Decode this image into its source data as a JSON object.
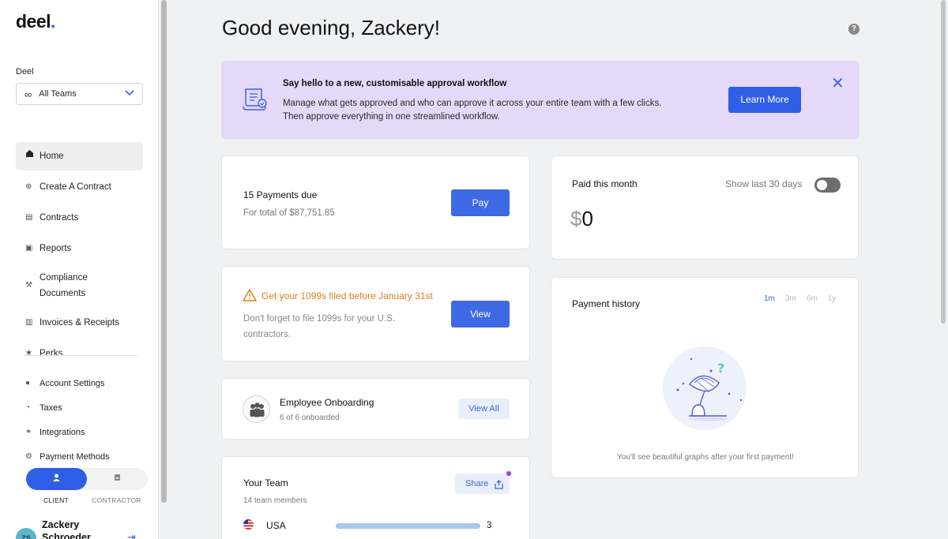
{
  "brand": {
    "name": "deel",
    "dot": "."
  },
  "sidebar": {
    "org_label": "Deel",
    "team_select": {
      "value": "All Teams"
    },
    "nav": [
      {
        "label": "Home",
        "icon": "home-icon",
        "active": true
      },
      {
        "label": "Create A Contract",
        "icon": "plus-circle-icon"
      },
      {
        "label": "Contracts",
        "icon": "document-icon"
      },
      {
        "label": "Reports",
        "icon": "reports-icon"
      },
      {
        "label": "Compliance Documents",
        "icon": "wrench-icon"
      },
      {
        "label": "Invoices & Receipts",
        "icon": "invoice-icon"
      },
      {
        "label": "Perks",
        "icon": "star-icon"
      }
    ],
    "nav_secondary": [
      {
        "label": "Account Settings",
        "icon": "user-icon"
      },
      {
        "label": "Taxes",
        "icon": "pie-icon"
      },
      {
        "label": "Integrations",
        "icon": "link-icon"
      },
      {
        "label": "Payment Methods",
        "icon": "gear-icon"
      }
    ],
    "role_toggle": {
      "client_label": "CLIENT",
      "contractor_label": "CONTRACTOR",
      "selected": "CLIENT"
    },
    "user": {
      "initials": "ZS",
      "name": "Zackery Schroeder"
    }
  },
  "main": {
    "greeting": "Good evening, Zackery!",
    "help_icon": "?",
    "banner": {
      "title": "Say hello to a new, customisable approval workflow",
      "text": "Manage what gets approved and who can approve it across your entire team with a few clicks. Then approve everything in one streamlined workflow.",
      "button": "Learn More",
      "close": "✕",
      "bg_color": "#e5d8f8"
    },
    "payments": {
      "title": "15 Payments due",
      "subtitle": "For total of $87,751.85",
      "button": "Pay"
    },
    "tax_1099": {
      "title": "Get your 1099s filed before January 31st",
      "subtitle": "Don't forget to file 1099s for your U.S. contractors.",
      "button": "View"
    },
    "onboarding": {
      "title": "Employee Onboarding",
      "subtitle": "6 of 6 onboarded",
      "button": "View All"
    },
    "team": {
      "title": "Your Team",
      "subtitle": "14 team members",
      "share_button": "Share",
      "countries": [
        {
          "name": "USA",
          "count": "3"
        }
      ]
    },
    "paid": {
      "title": "Paid this month",
      "toggle_label": "Show last 30 days",
      "toggle_on": false,
      "currency": "$",
      "amount": "0"
    },
    "history": {
      "title": "Payment history",
      "ranges": [
        "1m",
        "3m",
        "6m",
        "1y"
      ],
      "selected_range": "1m",
      "empty_note": "You'll see beautiful graphs after your first payment!"
    }
  },
  "colors": {
    "accent": "#2f5fe6",
    "warning": "#e07e1e",
    "banner": "#e5d8f8"
  }
}
